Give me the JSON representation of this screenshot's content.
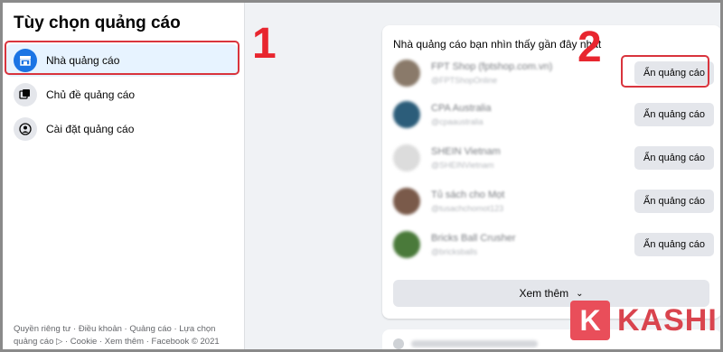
{
  "sidebar": {
    "title": "Tùy chọn quảng cáo",
    "items": [
      {
        "label": "Nhà quảng cáo",
        "icon": "storefront-icon",
        "active": true
      },
      {
        "label": "Chủ đề quảng cáo",
        "icon": "topics-icon",
        "active": false
      },
      {
        "label": "Cài đặt quảng cáo",
        "icon": "person-settings-icon",
        "active": false
      }
    ],
    "footer_line1": "Quyền riêng tư · Điều khoản · Quảng cáo · Lựa chọn",
    "footer_line2": "quảng cáo ▷ · Cookie · Xem thêm · Facebook © 2021"
  },
  "annotations": {
    "step1": "1",
    "step2": "2"
  },
  "main": {
    "title": "Nhà quảng cáo bạn nhìn thấy gần đây nhất",
    "advertisers": [
      {
        "name": "FPT Shop (fptshop.com.vn)",
        "handle": "@FPTShopOnline",
        "button": "Ẩn quảng cáo",
        "avatar_color": "#8a7a6a"
      },
      {
        "name": "CPA Australia",
        "handle": "@cpaaustralia",
        "button": "Ẩn quảng cáo",
        "avatar_color": "#2c5d7a"
      },
      {
        "name": "SHEIN Vietnam",
        "handle": "@SHEINVietnam",
        "button": "Ẩn quảng cáo",
        "avatar_color": "#dcdcdc"
      },
      {
        "name": "Tủ sách cho Mọt",
        "handle": "@tusachchomot123",
        "button": "Ẩn quảng cáo",
        "avatar_color": "#7a5a4a"
      },
      {
        "name": "Bricks Ball Crusher",
        "handle": "@bricksballs",
        "button": "Ẩn quảng cáo",
        "avatar_color": "#4a7a3a"
      }
    ],
    "see_more": "Xem thêm"
  },
  "watermark": {
    "letter": "K",
    "text": "KASHI"
  },
  "colors": {
    "accent": "#1b74e4",
    "highlight_red": "#d9343d"
  }
}
